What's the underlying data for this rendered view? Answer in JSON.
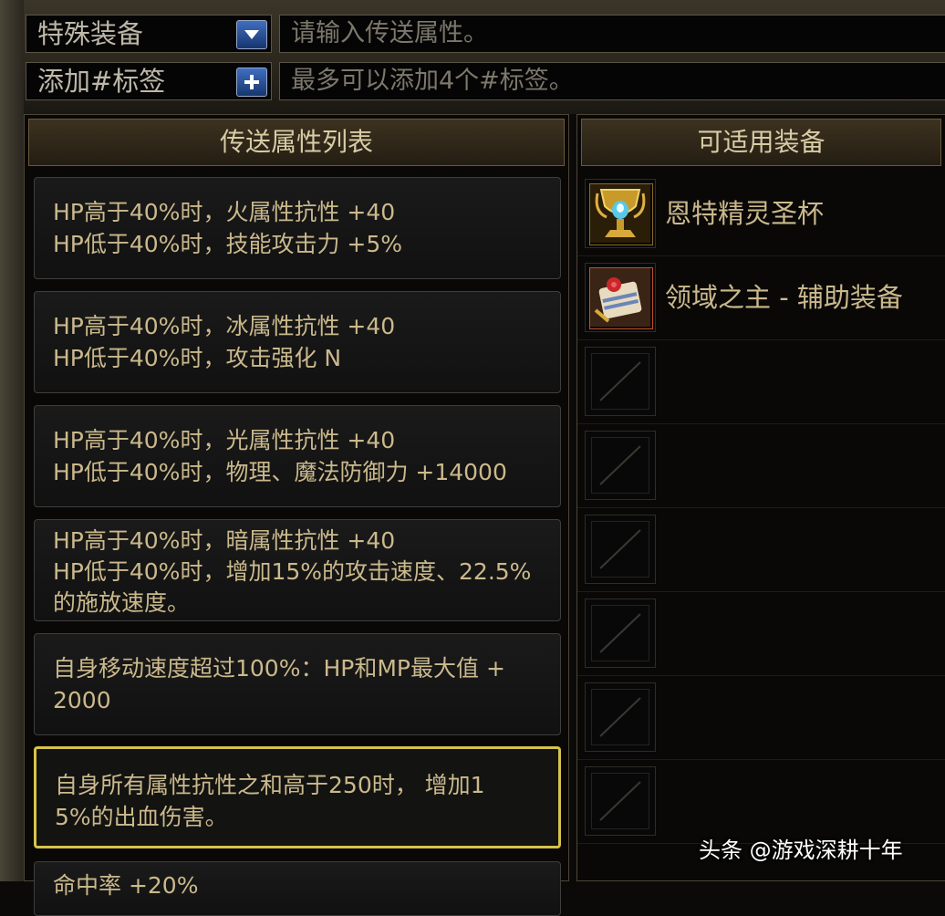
{
  "filter": {
    "category_value": "特殊装备",
    "attribute_placeholder": "请输入传送属性。",
    "tag_label": "添加#标签",
    "tag_placeholder": "最多可以添加4个#标签。"
  },
  "attribute_list": {
    "title": "传送属性列表",
    "items": [
      {
        "line1": "HP高于40%时，火属性抗性 +40",
        "line2": "HP低于40%时，技能攻击力 +5%",
        "line3": ""
      },
      {
        "line1": "HP高于40%时，冰属性抗性 +40",
        "line2": "HP低于40%时，攻击强化 N",
        "line3": ""
      },
      {
        "line1": "HP高于40%时，光属性抗性 +40",
        "line2": "HP低于40%时，物理、魔法防御力 +14000",
        "line3": ""
      },
      {
        "line1": "HP高于40%时，暗属性抗性 +40",
        "line2": "HP低于40%时，增加15%的攻击速度、22.5%",
        "line3": "的施放速度。"
      },
      {
        "line1": "自身移动速度超过100%：HP和MP最大值 +",
        "line2": "2000",
        "line3": ""
      },
      {
        "line1": "自身所有属性抗性之和高于250时， 增加1",
        "line2": "5%的出血伤害。",
        "line3": ""
      },
      {
        "line1": "命中率 +20%",
        "line2": "",
        "line3": ""
      }
    ],
    "selected_index": 5
  },
  "equipment": {
    "title": "可适用装备",
    "items": [
      {
        "name": "恩特精灵圣杯",
        "icon": "chalice-icon"
      },
      {
        "name": "领域之主 - 辅助装备",
        "icon": "scroll-icon"
      }
    ],
    "empty_slots": 6
  },
  "watermark": "头条 @游戏深耕十年",
  "colors": {
    "accent_gold": "#d6c34a",
    "text_gold": "#cbb98c",
    "button_blue": "#3f6fc0"
  }
}
